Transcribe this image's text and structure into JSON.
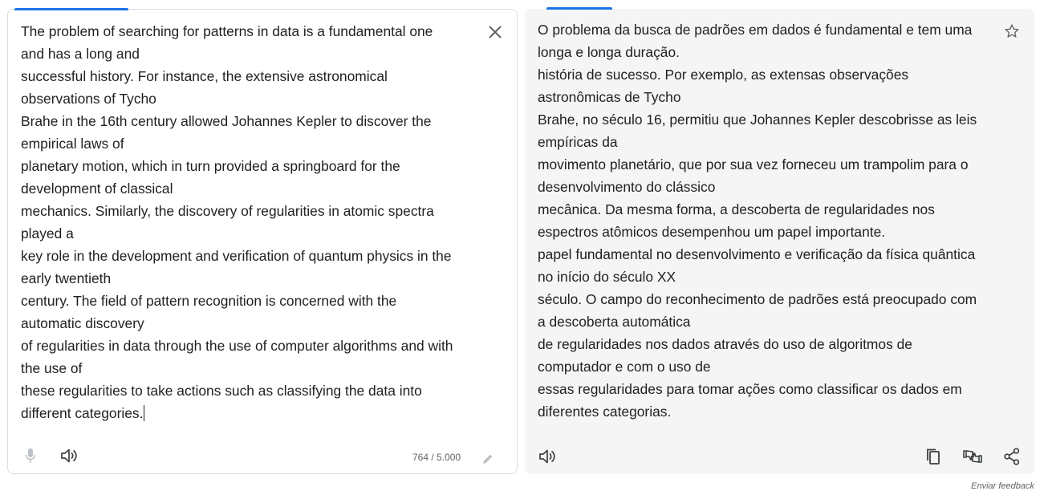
{
  "source": {
    "text": "The problem of searching for patterns in data is a fundamental one\nand has a long and\nsuccessful history. For instance, the extensive astronomical\nobservations of Tycho\nBrahe in the 16th century allowed Johannes Kepler to discover the\nempirical laws of\nplanetary motion, which in turn provided a springboard for the\ndevelopment of classical\nmechanics. Similarly, the discovery of regularities in atomic spectra\nplayed a\nkey role in the development and verification of quantum physics in the\nearly twentieth\ncentury. The field of pattern recognition is concerned with the\nautomatic discovery\nof regularities in data through the use of computer algorithms and with\nthe use of\nthese regularities to take actions such as classifying the data into\ndifferent categories.",
    "char_count": "764 / 5.000",
    "icons": [
      "close-icon",
      "microphone-icon",
      "speaker-icon",
      "pencil-icon"
    ]
  },
  "target": {
    "text": "O problema da busca de padrões em dados é fundamental e tem uma\nlonga e longa duração.\nhistória de sucesso. Por exemplo, as extensas observações\nastronômicas de Tycho\nBrahe, no século 16, permitiu que Johannes Kepler descobrisse as leis\nempíricas da\nmovimento planetário, que por sua vez forneceu um trampolim para o\ndesenvolvimento do clássico\nmecânica. Da mesma forma, a descoberta de regularidades nos\nespectros atômicos desempenhou um papel importante.\npapel fundamental no desenvolvimento e verificação da física quântica\nno início do século XX\nséculo. O campo do reconhecimento de padrões está preocupado com\na descoberta automática\nde regularidades nos dados através do uso de algoritmos de\ncomputador e com o uso de\nessas regularidades para tomar ações como classificar os dados em\ndiferentes categorias.",
    "icons": [
      "star-icon",
      "speaker-icon",
      "copy-icon",
      "feedback-thumbs-icon",
      "share-icon"
    ]
  },
  "footer": {
    "feedback_label": "Enviar feedback"
  },
  "colors": {
    "accent": "#1a73e8",
    "target_bg": "#f5f5f5",
    "icon": "#5f6368",
    "icon_disabled": "#bdc1c6"
  }
}
